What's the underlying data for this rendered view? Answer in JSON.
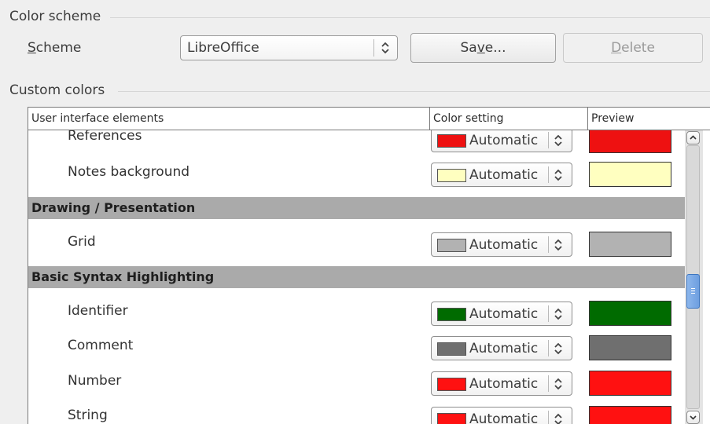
{
  "color_scheme": {
    "section_title": "Color scheme",
    "scheme_label_prefix": "S",
    "scheme_label_rest": "cheme",
    "scheme_value": "LibreOffice",
    "save_button_pre": "Sa",
    "save_button_mnemonic": "v",
    "save_button_post": "e...",
    "delete_button_mnemonic": "D",
    "delete_button_rest": "elete"
  },
  "custom_colors": {
    "section_title": "Custom colors",
    "columns": [
      "User interface elements",
      "Color setting",
      "Preview"
    ],
    "rows": [
      {
        "type": "item",
        "label": "References",
        "setting": "Automatic",
        "color": "#ee1111"
      },
      {
        "type": "item",
        "label": "Notes background",
        "setting": "Automatic",
        "color": "#ffffc0"
      },
      {
        "type": "category",
        "label": "Drawing / Presentation"
      },
      {
        "type": "item",
        "label": "Grid",
        "setting": "Automatic",
        "color": "#b2b2b2"
      },
      {
        "type": "category",
        "label": "Basic Syntax Highlighting"
      },
      {
        "type": "item",
        "label": "Identifier",
        "setting": "Automatic",
        "color": "#006b00"
      },
      {
        "type": "item",
        "label": "Comment",
        "setting": "Automatic",
        "color": "#6f6f6f"
      },
      {
        "type": "item",
        "label": "Number",
        "setting": "Automatic",
        "color": "#ff1111"
      },
      {
        "type": "item",
        "label": "String",
        "setting": "Automatic",
        "color": "#ff1111"
      }
    ]
  }
}
